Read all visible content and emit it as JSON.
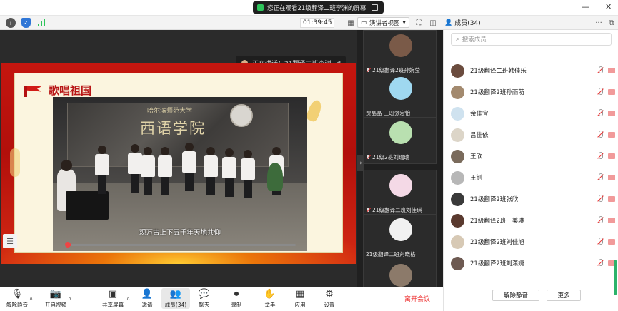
{
  "titlebar": {
    "share_status": "您正在观看21级翻译二班李渊的屏幕",
    "minimize": "—",
    "close": "✕"
  },
  "topbar": {
    "timer": "01:39:45",
    "view_label": "演讲者视图",
    "member_count": "成员(34)",
    "more": "···"
  },
  "stage": {
    "speaking": "正在讲话：21翻译二班李渊",
    "slide_title": "歌唱祖国",
    "video": {
      "school_name": "哈尔滨师范大学",
      "dept_name": "西语学院",
      "subtitle": "观万古上下五千年天地共仰"
    }
  },
  "gallery": [
    {
      "name": "21级翻译2班孙婉莹",
      "muted": true,
      "avatar_color": "#7a5a48"
    },
    {
      "name": "贾晶晶 三班张宏怡",
      "muted": false,
      "avatar_color": "#9fd8f0"
    },
    {
      "name": "21级2班刘瑞瑞",
      "muted": true,
      "avatar_color": "#b9e0b0"
    },
    {
      "name": "21级翻译二班刘佳琪",
      "muted": true,
      "avatar_color": "#f4d9e6"
    },
    {
      "name": "21级翻译二班刘晓格",
      "muted": false,
      "avatar_color": "#f1f1f1"
    },
    {
      "name": "",
      "muted": false,
      "avatar_color": "#8c7a6a"
    }
  ],
  "participants_panel": {
    "search_placeholder": "搜索成员",
    "members": [
      {
        "name": "21级翻译二班韩佳乐",
        "avatar_color": "#6b4c3e"
      },
      {
        "name": "21级翻译2班孙雨萌",
        "avatar_color": "#a38a6f"
      },
      {
        "name": "余佳宜",
        "avatar_color": "#cfe2ef"
      },
      {
        "name": "吕佳依",
        "avatar_color": "#dcd5c8"
      },
      {
        "name": "王欣",
        "avatar_color": "#7a6b5c"
      },
      {
        "name": "王钊",
        "avatar_color": "#b7b7b7"
      },
      {
        "name": "21级翻译2班张欣",
        "avatar_color": "#3a3a3a"
      },
      {
        "name": "21级翻译2班于美琳",
        "avatar_color": "#5a3a2f"
      },
      {
        "name": "21级翻译2班刘佳旭",
        "avatar_color": "#d7c9b5"
      },
      {
        "name": "21级翻译2班刘潇婕",
        "avatar_color": "#6e5a52"
      }
    ],
    "unmute_all": "解除静音",
    "more_btn": "更多"
  },
  "bottombar": {
    "tools": [
      {
        "label": "解除静音",
        "icon": "mic-muted-icon"
      },
      {
        "label": "开启视频",
        "icon": "camera-off-icon"
      },
      {
        "label": "共享屏幕",
        "icon": "share-screen-icon"
      },
      {
        "label": "邀请",
        "icon": "invite-icon"
      },
      {
        "label": "成员(34)",
        "icon": "members-icon"
      },
      {
        "label": "聊天",
        "icon": "chat-icon"
      },
      {
        "label": "录制",
        "icon": "record-icon"
      },
      {
        "label": "举手",
        "icon": "raise-hand-icon"
      },
      {
        "label": "应用",
        "icon": "apps-icon"
      },
      {
        "label": "设置",
        "icon": "settings-icon"
      }
    ],
    "leave": "离开会议"
  },
  "colors": {
    "accent_green": "#2ec45b",
    "leave_red": "#e33333",
    "slide_red": "#c4160f"
  }
}
